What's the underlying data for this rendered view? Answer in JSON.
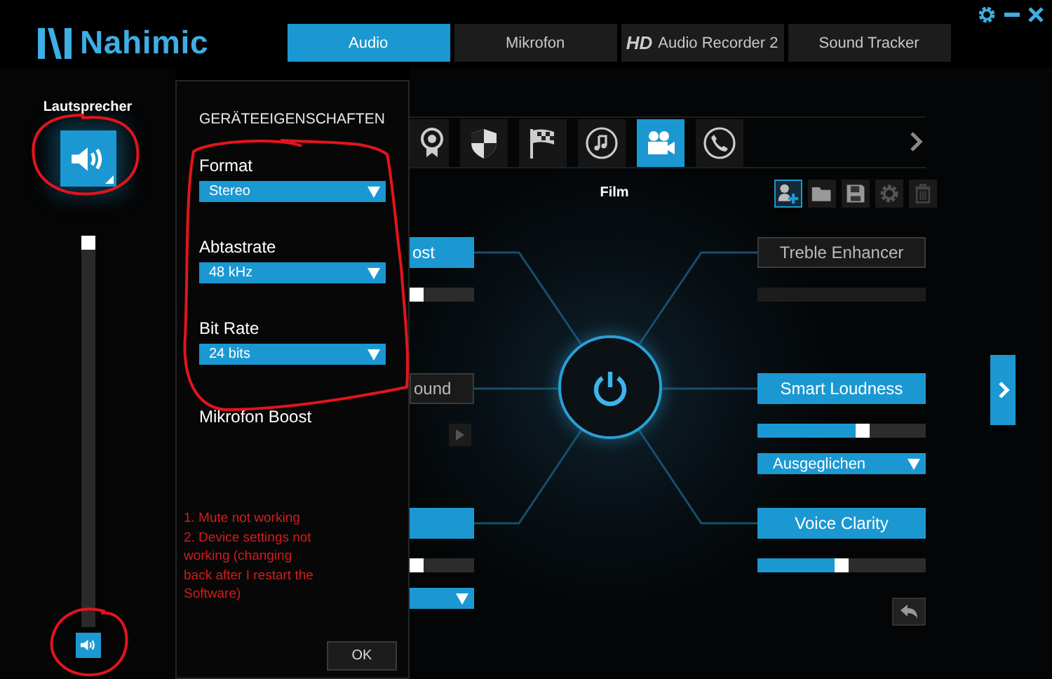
{
  "app": {
    "logo": "Nahimic"
  },
  "tabs": [
    {
      "label": "Audio",
      "selected": true
    },
    {
      "label": "Mikrofon",
      "selected": false
    },
    {
      "badge": "HD",
      "label": "Audio Recorder 2",
      "selected": false
    },
    {
      "label": "Sound Tracker",
      "selected": false
    }
  ],
  "device": {
    "name": "Lautsprecher",
    "level": 1,
    "muted": false
  },
  "dialog": {
    "title": "GERÄTEEIGENSCHAFTEN",
    "fields": [
      {
        "label": "Format",
        "value": "Stereo"
      },
      {
        "label": "Abtastrate",
        "value": "48 kHz"
      },
      {
        "label": "Bit Rate",
        "value": "24 bits"
      }
    ],
    "extra_label": "Mikrofon Boost",
    "button": "OK"
  },
  "annotation": {
    "lines": [
      "1. Mute not working",
      "2. Device settings not working (changing back after I restart the Software)"
    ]
  },
  "profiles": [
    {
      "kind": "medal",
      "selected": false
    },
    {
      "kind": "shield",
      "selected": false
    },
    {
      "kind": "flag",
      "selected": false
    },
    {
      "kind": "music",
      "selected": false
    },
    {
      "kind": "camera",
      "selected": true
    },
    {
      "kind": "phone",
      "selected": false
    }
  ],
  "profile_name": "Film",
  "features": [
    {
      "kind": "slider",
      "label": "ost",
      "on": true,
      "level": 0
    },
    {
      "kind": "player",
      "label": "ound",
      "on": false
    },
    {
      "kind": "slider_dropdown",
      "on": true,
      "level": 0
    },
    {
      "kind": "slider",
      "label": "Treble Enhancer",
      "on": false
    },
    {
      "kind": "slider_dropdown",
      "label": "Smart Loudness",
      "on": true,
      "level": 0.64,
      "dropdown": "Ausgeglichen"
    },
    {
      "kind": "slider",
      "label": "Voice Clarity",
      "on": true,
      "level": 0.5
    }
  ]
}
